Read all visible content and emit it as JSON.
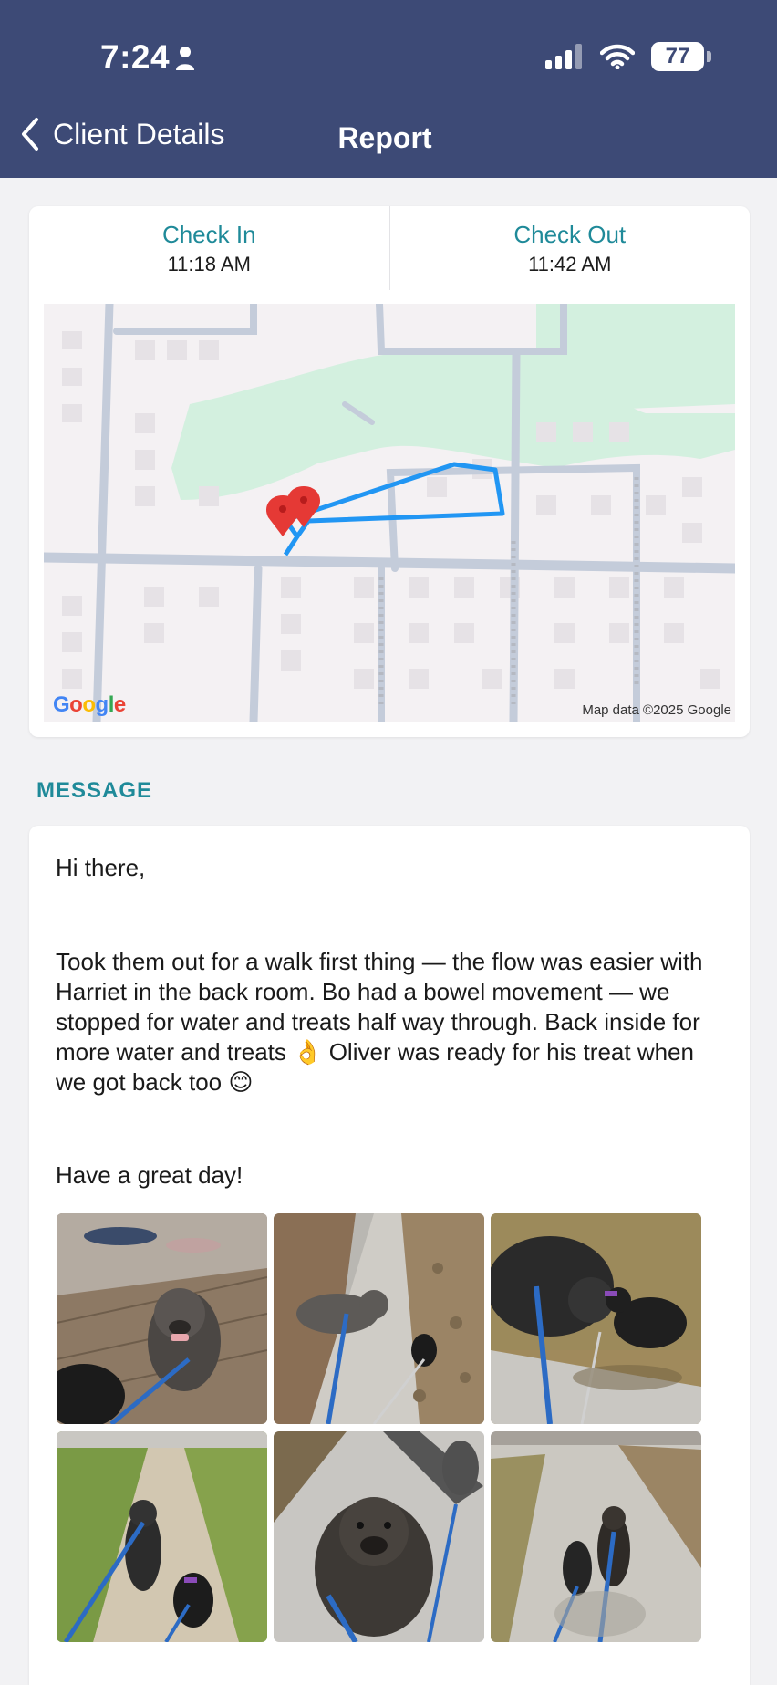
{
  "status_bar": {
    "time": "7:24",
    "battery": "77"
  },
  "nav": {
    "back_label": "Client Details",
    "title": "Report"
  },
  "visit": {
    "check_in_label": "Check In",
    "check_in_time": "11:18 AM",
    "check_out_label": "Check Out",
    "check_out_time": "11:42 AM"
  },
  "map": {
    "logo": "Google",
    "attribution": "Map data ©2025 Google"
  },
  "message": {
    "section_title": "MESSAGE",
    "greeting": "Hi there,",
    "body": "Took them out for a walk first thing — the flow was easier with Harriet in the back room. Bo had a bowel movement — we stopped for water and treats half way through. Back inside for more water and treats 👌 Oliver was ready for his treat when we got back too 😊",
    "signoff": "Have a great day!"
  },
  "photos": [
    "dog-on-floor-photo",
    "two-dogs-sidewalk-photo",
    "dogs-on-grass-photo",
    "dogs-walking-sidewalk-photo",
    "dog-looking-up-photo",
    "dogs-ahead-sidewalk-photo"
  ],
  "colors": {
    "header_bg": "#3d4a76",
    "accent": "#1f8a99",
    "route": "#2196f3",
    "pin": "#e53935"
  }
}
